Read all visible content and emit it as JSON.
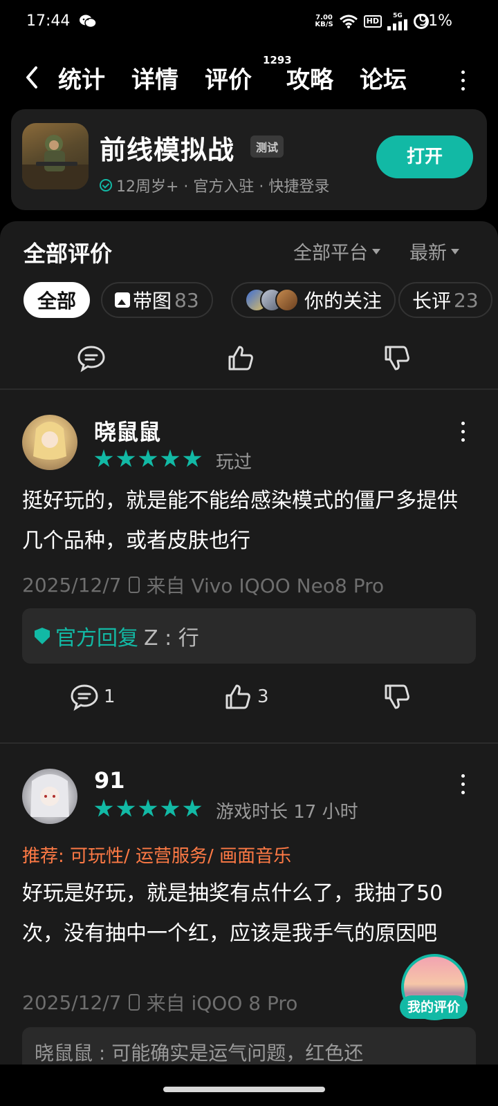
{
  "status_bar": {
    "time": "17:44",
    "net_speed_value": "7.00",
    "net_speed_unit": "KB/S",
    "hd": "HD",
    "network": "5G",
    "battery": "91%"
  },
  "nav": {
    "tabs": [
      "统计",
      "详情",
      "评价",
      "攻略",
      "论坛"
    ],
    "active_tab": "评价",
    "review_badge": "1293"
  },
  "game": {
    "title": "前线模拟战",
    "badge": "测试",
    "meta": "12周岁+ · 官方入驻 · 快捷登录",
    "open_button": "打开"
  },
  "reviews_header": {
    "title": "全部评价",
    "platform_filter": "全部平台",
    "sort_filter": "最新"
  },
  "chips": {
    "all": "全部",
    "with_images": "带图",
    "with_images_count": "83",
    "following": "你的关注",
    "long": "长评",
    "long_count": "23"
  },
  "reviews": [
    {
      "username": "晓鼠鼠",
      "status": "玩过",
      "content": "挺好玩的，就是能不能给感染模式的僵尸多提供几个品种，或者皮肤也行",
      "date": "2025/12/7",
      "device": "来自 Vivo IQOO Neo8 Pro",
      "official_label": "官方回复",
      "official_reply": "Z : 行",
      "comments": "1",
      "likes": "3"
    },
    {
      "username": "91",
      "status": "游戏时长 17 小时",
      "tags": "推荐: 可玩性/ 运营服务/ 画面音乐",
      "content": "好玩是好玩，就是抽奖有点什么了，我抽了50次，没有抽中一个红，应该是我手气的原因吧",
      "date": "2025/12/7",
      "device": "来自 iQOO 8 Pro",
      "reply_preview": "晓鼠鼠 : 可能确实是运气问题，红色还"
    }
  ],
  "fab_label": "我的评价",
  "colors": {
    "accent": "#12b9a5",
    "tag": "#ff7a45",
    "background": "#000000",
    "panel": "#1b1b1b"
  }
}
